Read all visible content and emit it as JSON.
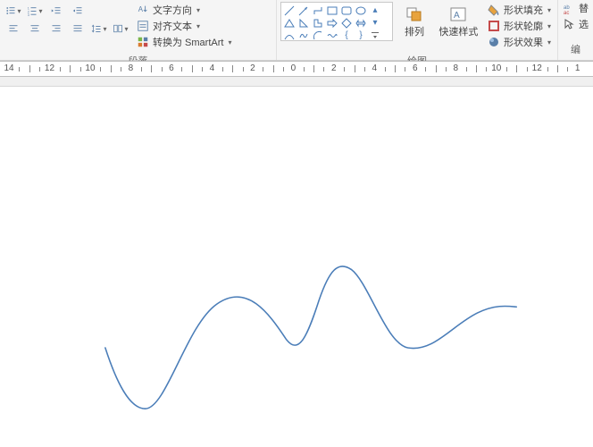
{
  "ribbon": {
    "paragraph": {
      "label": "段落",
      "text_direction": "文字方向",
      "align_text": "对齐文本",
      "convert_smartart": "转换为 SmartArt"
    },
    "drawing": {
      "label": "绘图",
      "arrange": "排列",
      "quick_styles": "快速样式",
      "shape_fill": "形状填充",
      "shape_outline": "形状轮廓",
      "shape_effects": "形状效果"
    },
    "editing": {
      "label": "编",
      "replace": "替",
      "select": "选"
    }
  },
  "ruler": {
    "marks": [
      "14",
      "12",
      "10",
      "8",
      "6",
      "4",
      "2",
      "0",
      "2",
      "4",
      "6",
      "8",
      "10",
      "12",
      "1"
    ]
  }
}
